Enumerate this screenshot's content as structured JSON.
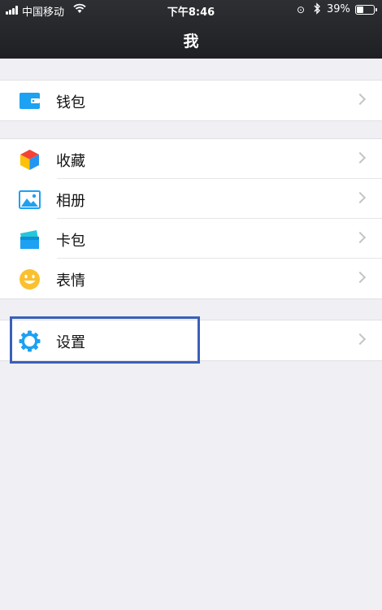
{
  "status": {
    "carrier": "中国移动",
    "time": "下午8:46",
    "battery_pct": "39%",
    "battery_level": 0.39
  },
  "header": {
    "title": "我"
  },
  "groups": [
    {
      "items": [
        {
          "label": "钱包",
          "icon": "wallet-icon"
        }
      ]
    },
    {
      "items": [
        {
          "label": "收藏",
          "icon": "favorites-cube-icon"
        },
        {
          "label": "相册",
          "icon": "album-image-icon"
        },
        {
          "label": "卡包",
          "icon": "card-wallet-icon"
        },
        {
          "label": "表情",
          "icon": "smiley-face-icon"
        }
      ]
    },
    {
      "items": [
        {
          "label": "设置",
          "icon": "gear-icon"
        }
      ]
    }
  ],
  "colors": {
    "highlight": "#3a60b8",
    "icon_blue": "#1da1f2"
  }
}
